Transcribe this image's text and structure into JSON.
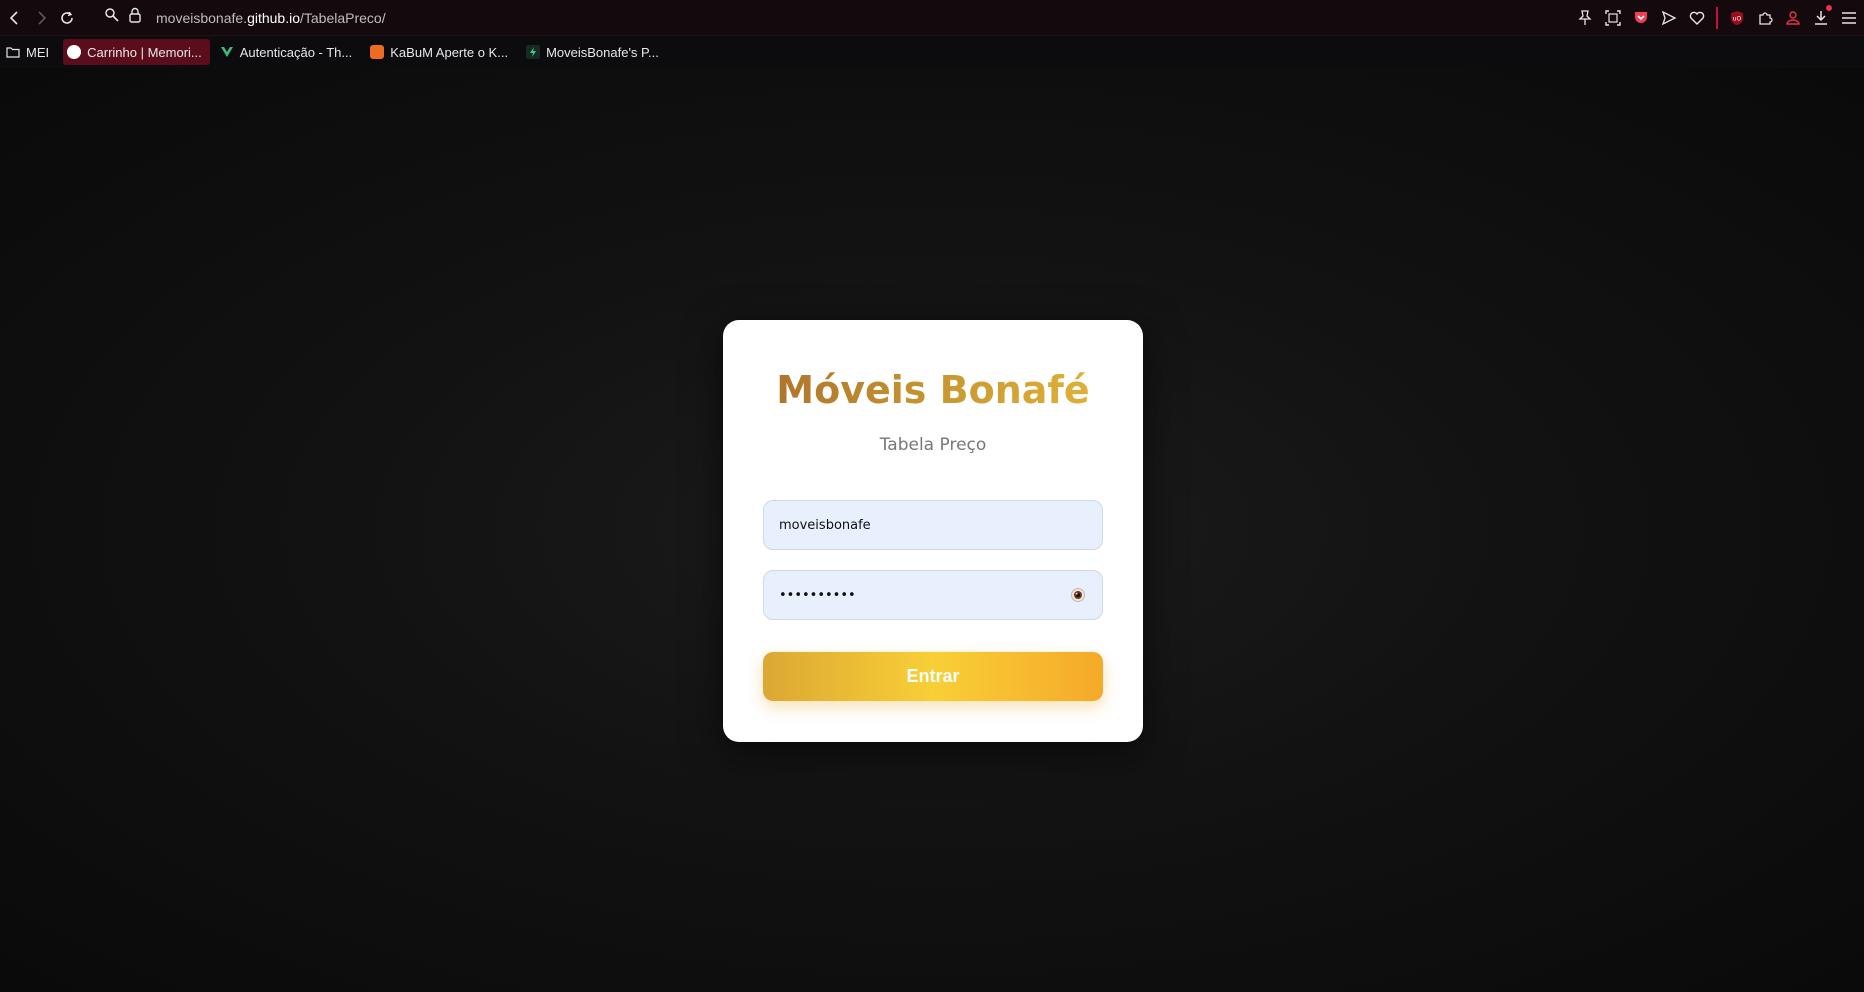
{
  "browser": {
    "url_prefix": "moveisbonafe.",
    "url_host": "github.io",
    "url_path": "/TabelaPreco/",
    "accent_color": "#c4103a",
    "bookmarks": [
      {
        "label": "MEI",
        "icon": "folder-icon"
      },
      {
        "label": "Carrinho | Memori...",
        "icon": "site-favicon",
        "active": true
      },
      {
        "label": "Autenticação - Th...",
        "icon": "vue-favicon"
      },
      {
        "label": "KaBuM Aperte o K...",
        "icon": "kabum-favicon"
      },
      {
        "label": "MoveisBonafe's P...",
        "icon": "bolt-favicon"
      }
    ]
  },
  "login": {
    "title": "Móveis Bonafé",
    "subtitle": "Tabela Preço",
    "username_value": "moveisbonafe",
    "password_masked": "••••••••••",
    "submit_label": "Entrar",
    "title_gradient": [
      "#a8692a",
      "#e8b93a"
    ],
    "button_gradient": [
      "#dba834",
      "#f6a92a"
    ]
  }
}
